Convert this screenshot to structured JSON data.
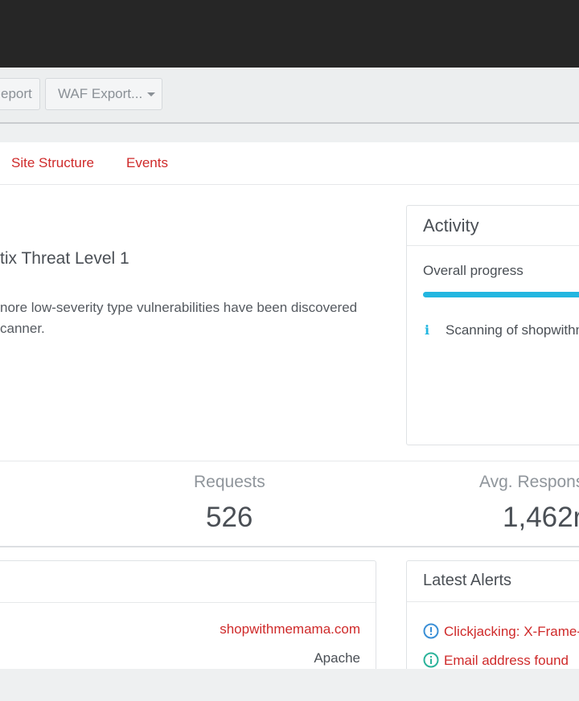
{
  "toolbar": {
    "report_label": "eport",
    "waf_export_label": "WAF Export..."
  },
  "tabs": [
    {
      "label": "Site Structure"
    },
    {
      "label": "Events"
    }
  ],
  "threat": {
    "title": "tix Threat Level 1",
    "description_line1": "nore low-severity type vulnerabilities have been discovered",
    "description_line2": "canner."
  },
  "activity": {
    "title": "Activity",
    "progress_label": "Overall progress",
    "progress_percent": 100,
    "scan_text": "Scanning of shopwithm"
  },
  "stats": {
    "requests_label": "Requests",
    "requests_value": "526",
    "avg_response_label": "Avg. Respons",
    "avg_response_value": "1,462r"
  },
  "target_info": {
    "address": "shopwithmemama.com",
    "server": "Apache"
  },
  "latest_alerts": {
    "title": "Latest Alerts",
    "items": [
      {
        "label": "Clickjacking: X-Frame-C",
        "icon": "alert-circle-icon",
        "color": "#3a8fd6"
      },
      {
        "label": "Email address found",
        "icon": "info-circle-icon",
        "color": "#2bb39a"
      }
    ]
  },
  "colors": {
    "accent_red": "#cf2a2a",
    "progress_blue": "#22b6e0"
  }
}
